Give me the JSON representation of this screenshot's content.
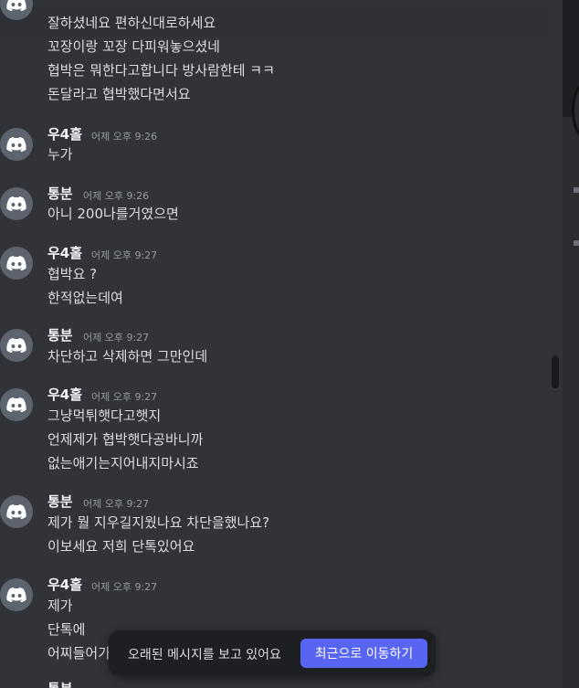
{
  "messages_top": [
    "잘하셨네요 편하신대로하세요",
    "꼬장이랑 꼬장 다피워놓으셨네",
    "협박은 뭐한다고합니다 방사람한테 ㅋㅋ",
    "돈달라고 협박했다면서요"
  ],
  "groups": [
    {
      "user": "우4홀",
      "time": "어제 오후 9:26",
      "lines": [
        "누가"
      ]
    },
    {
      "user": "통분",
      "time": "어제 오후 9:26",
      "lines": [
        "아니 200나를거였으면"
      ]
    },
    {
      "user": "우4홀",
      "time": "어제 오후 9:27",
      "lines": [
        "협박요 ?",
        "한적없는데여"
      ]
    },
    {
      "user": "통분",
      "time": "어제 오후 9:27",
      "lines": [
        "차단하고 삭제하면 그만인데"
      ]
    },
    {
      "user": "우4홀",
      "time": "어제 오후 9:27",
      "lines": [
        "그냥먹튀햇다고햇지",
        "언제제가 협박햇다공바니까",
        "없는애기는지어내지마시죠"
      ]
    },
    {
      "user": "통분",
      "time": "어제 오후 9:27",
      "lines": [
        "제가 뭘 지우길지웠나요 차단을했나요?",
        "이보세요 저희 단톡있어요"
      ]
    },
    {
      "user": "우4홀",
      "time": "어제 오후 9:27",
      "lines": [
        "제가",
        "단톡에",
        "어찌들어가"
      ]
    },
    {
      "user": "통분",
      "time": "",
      "lines": []
    }
  ],
  "toast": {
    "text": "오래된 메시지를 보고 있어요",
    "button": "최근으로 이동하기"
  },
  "icons": {
    "avatar": "discord-logo-icon"
  },
  "colors": {
    "background": "#313338",
    "accent": "#5865f2",
    "avatar": "#5d646e"
  }
}
